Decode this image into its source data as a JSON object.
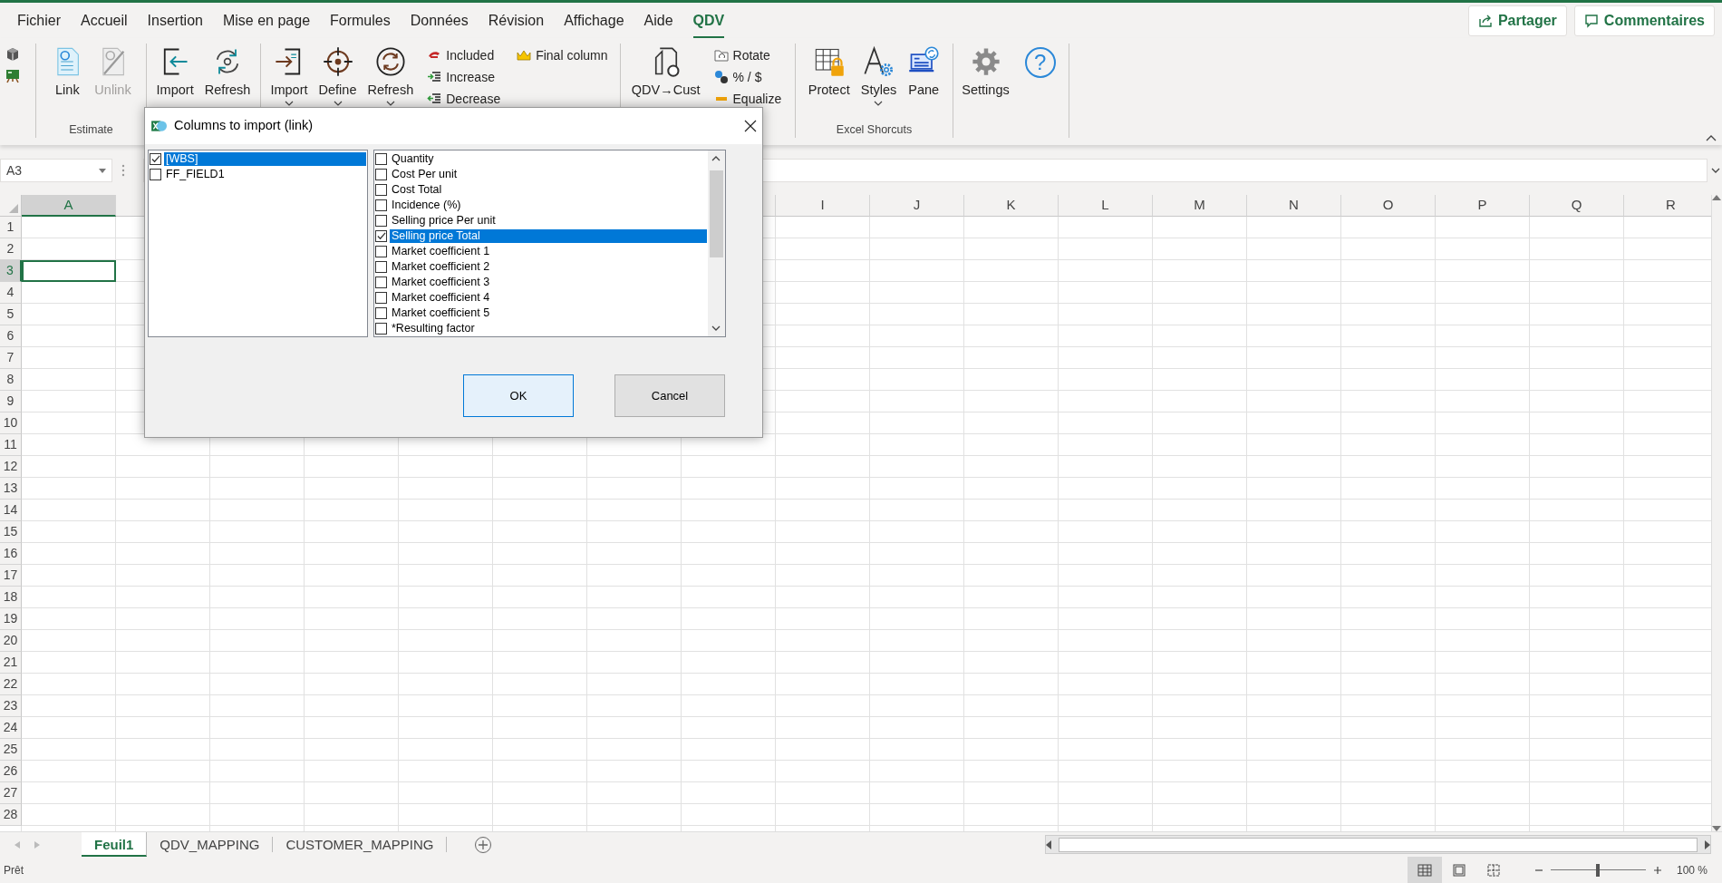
{
  "ribbon_tabs": [
    {
      "label": "Fichier",
      "selected": false
    },
    {
      "label": "Accueil",
      "selected": false
    },
    {
      "label": "Insertion",
      "selected": false
    },
    {
      "label": "Mise en page",
      "selected": false
    },
    {
      "label": "Formules",
      "selected": false
    },
    {
      "label": "Données",
      "selected": false
    },
    {
      "label": "Révision",
      "selected": false
    },
    {
      "label": "Affichage",
      "selected": false
    },
    {
      "label": "Aide",
      "selected": false
    },
    {
      "label": "QDV",
      "selected": true
    }
  ],
  "header_buttons": [
    {
      "label": "Partager"
    },
    {
      "label": "Commentaires"
    }
  ],
  "ribbon_groups": [
    {
      "label": "Estimate",
      "items": [
        {
          "kind": "large",
          "label": "Link",
          "disabled": false,
          "dropdown": false
        },
        {
          "kind": "large",
          "label": "Unlink",
          "disabled": true,
          "dropdown": false
        }
      ]
    },
    {
      "items": [
        {
          "kind": "large",
          "label": "Import",
          "disabled": false,
          "dropdown": false
        },
        {
          "kind": "large",
          "label": "Refresh",
          "disabled": false,
          "dropdown": false
        }
      ]
    },
    {
      "items": [
        {
          "kind": "large",
          "label": "Import",
          "disabled": false,
          "dropdown": true
        },
        {
          "kind": "large",
          "label": "Define",
          "disabled": false,
          "dropdown": true
        },
        {
          "kind": "large",
          "label": "Refresh",
          "disabled": false,
          "dropdown": true
        },
        {
          "kind": "column",
          "items": [
            {
              "label": "Included"
            },
            {
              "label": "Increase"
            },
            {
              "label": "Decrease"
            }
          ]
        },
        {
          "kind": "column",
          "items": [
            {
              "label": "Final column"
            }
          ]
        }
      ]
    },
    {
      "items": [
        {
          "kind": "large",
          "label": "QDV→Cust",
          "disabled": false,
          "dropdown": false
        },
        {
          "kind": "column",
          "items": [
            {
              "label": "Rotate"
            },
            {
              "label": "% / $"
            },
            {
              "label": "Equalize"
            }
          ]
        }
      ]
    },
    {
      "label": "Excel Shorcuts",
      "items": [
        {
          "kind": "large",
          "label": "Protect",
          "disabled": false,
          "dropdown": false
        },
        {
          "kind": "large",
          "label": "Styles",
          "disabled": false,
          "dropdown": true
        },
        {
          "kind": "large",
          "label": "Pane",
          "disabled": false,
          "dropdown": false
        }
      ]
    },
    {
      "items": [
        {
          "kind": "large",
          "label": "Settings",
          "disabled": false,
          "dropdown": false
        },
        {
          "kind": "glyph",
          "label": "?"
        }
      ]
    }
  ],
  "name_box": {
    "value": "A3"
  },
  "columns": [
    {
      "label": "A",
      "selected": true
    },
    {
      "label": "I",
      "selected": false
    },
    {
      "label": "J",
      "selected": false
    },
    {
      "label": "K",
      "selected": false
    },
    {
      "label": "L",
      "selected": false
    },
    {
      "label": "M",
      "selected": false
    },
    {
      "label": "N",
      "selected": false
    },
    {
      "label": "O",
      "selected": false
    },
    {
      "label": "P",
      "selected": false
    },
    {
      "label": "Q",
      "selected": false
    },
    {
      "label": "R",
      "selected": false
    }
  ],
  "rows": [
    {
      "label": "1",
      "selected": false
    },
    {
      "label": "2",
      "selected": false
    },
    {
      "label": "3",
      "selected": true
    },
    {
      "label": "4",
      "selected": false
    },
    {
      "label": "5",
      "selected": false
    },
    {
      "label": "6",
      "selected": false
    },
    {
      "label": "7",
      "selected": false
    },
    {
      "label": "8",
      "selected": false
    },
    {
      "label": "9",
      "selected": false
    },
    {
      "label": "10",
      "selected": false
    },
    {
      "label": "11",
      "selected": false
    },
    {
      "label": "12",
      "selected": false
    },
    {
      "label": "13",
      "selected": false
    },
    {
      "label": "14",
      "selected": false
    },
    {
      "label": "15",
      "selected": false
    },
    {
      "label": "16",
      "selected": false
    },
    {
      "label": "17",
      "selected": false
    },
    {
      "label": "18",
      "selected": false
    },
    {
      "label": "19",
      "selected": false
    },
    {
      "label": "20",
      "selected": false
    },
    {
      "label": "21",
      "selected": false
    },
    {
      "label": "22",
      "selected": false
    },
    {
      "label": "23",
      "selected": false
    },
    {
      "label": "24",
      "selected": false
    },
    {
      "label": "25",
      "selected": false
    },
    {
      "label": "26",
      "selected": false
    },
    {
      "label": "27",
      "selected": false
    },
    {
      "label": "28",
      "selected": false
    }
  ],
  "dialog": {
    "title": "Columns to import (link)",
    "left_list": [
      {
        "label": "[WBS]",
        "checked": true,
        "selected": true
      },
      {
        "label": "FF_FIELD1",
        "checked": false,
        "selected": false
      }
    ],
    "right_list": [
      {
        "label": "Quantity",
        "checked": false,
        "selected": false
      },
      {
        "label": "Cost Per unit",
        "checked": false,
        "selected": false
      },
      {
        "label": "Cost Total",
        "checked": false,
        "selected": false
      },
      {
        "label": "Incidence (%)",
        "checked": false,
        "selected": false
      },
      {
        "label": "Selling price Per unit",
        "checked": false,
        "selected": false
      },
      {
        "label": "Selling price Total",
        "checked": true,
        "selected": true
      },
      {
        "label": "Market coefficient 1",
        "checked": false,
        "selected": false
      },
      {
        "label": "Market coefficient 2",
        "checked": false,
        "selected": false
      },
      {
        "label": "Market coefficient 3",
        "checked": false,
        "selected": false
      },
      {
        "label": "Market coefficient 4",
        "checked": false,
        "selected": false
      },
      {
        "label": "Market coefficient 5",
        "checked": false,
        "selected": false
      },
      {
        "label": "*Resulting factor",
        "checked": false,
        "selected": false
      }
    ],
    "buttons": [
      {
        "label": "OK",
        "kind": "default"
      },
      {
        "label": "Cancel",
        "kind": "normal"
      }
    ]
  },
  "sheet_tabs": [
    {
      "label": "Feuil1",
      "selected": true
    },
    {
      "label": "QDV_MAPPING",
      "selected": false
    },
    {
      "label": "CUSTOMER_MAPPING",
      "selected": false
    }
  ],
  "status_bar": {
    "text": "Prêt",
    "views": [
      {
        "selected": true
      },
      {
        "selected": false
      },
      {
        "selected": false
      }
    ],
    "zoom": {
      "level": 0.5,
      "reading": "100 %"
    }
  }
}
